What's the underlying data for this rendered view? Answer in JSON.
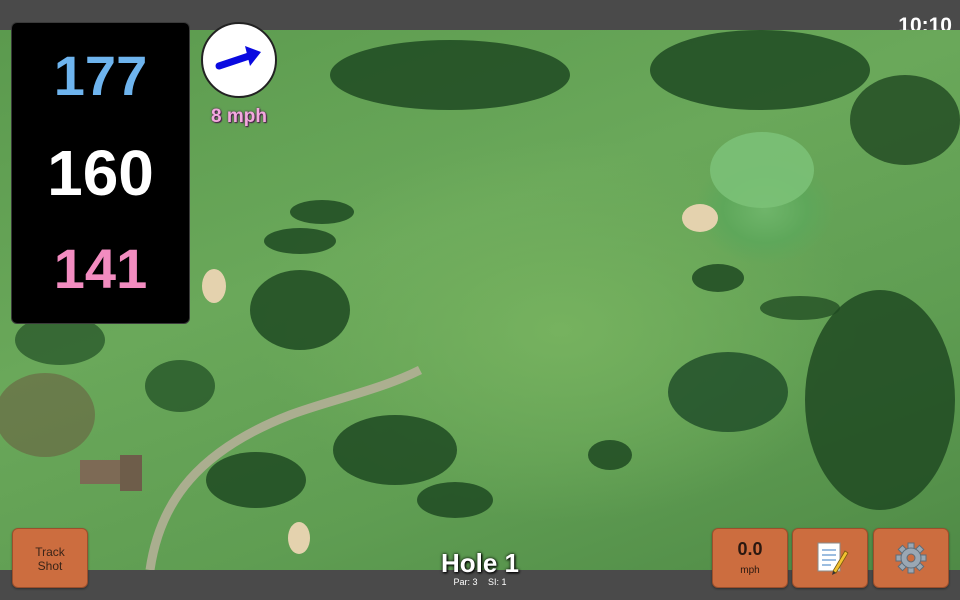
{
  "status": {
    "time": "10:10"
  },
  "distances": {
    "back": "177",
    "middle": "160",
    "front": "141"
  },
  "wind": {
    "speed_label": "8 mph",
    "icon": "wind-arrow-icon"
  },
  "hole": {
    "title": "Hole 1",
    "par_label": "Par: 3",
    "si_label": "SI: 1"
  },
  "buttons": {
    "track_shot_line1": "Track",
    "track_shot_line2": "Shot",
    "speed_value": "0.0",
    "speed_unit": "mph",
    "notes_icon": "notepad-icon",
    "settings_icon": "gear-icon"
  },
  "colors": {
    "back_distance": "#6eb4ee",
    "middle_distance": "#ffffff",
    "front_distance": "#f28cc0",
    "button": "#cc6d3f",
    "wind_text": "#f4a9df",
    "wind_arrow": "#0a0ae0"
  }
}
